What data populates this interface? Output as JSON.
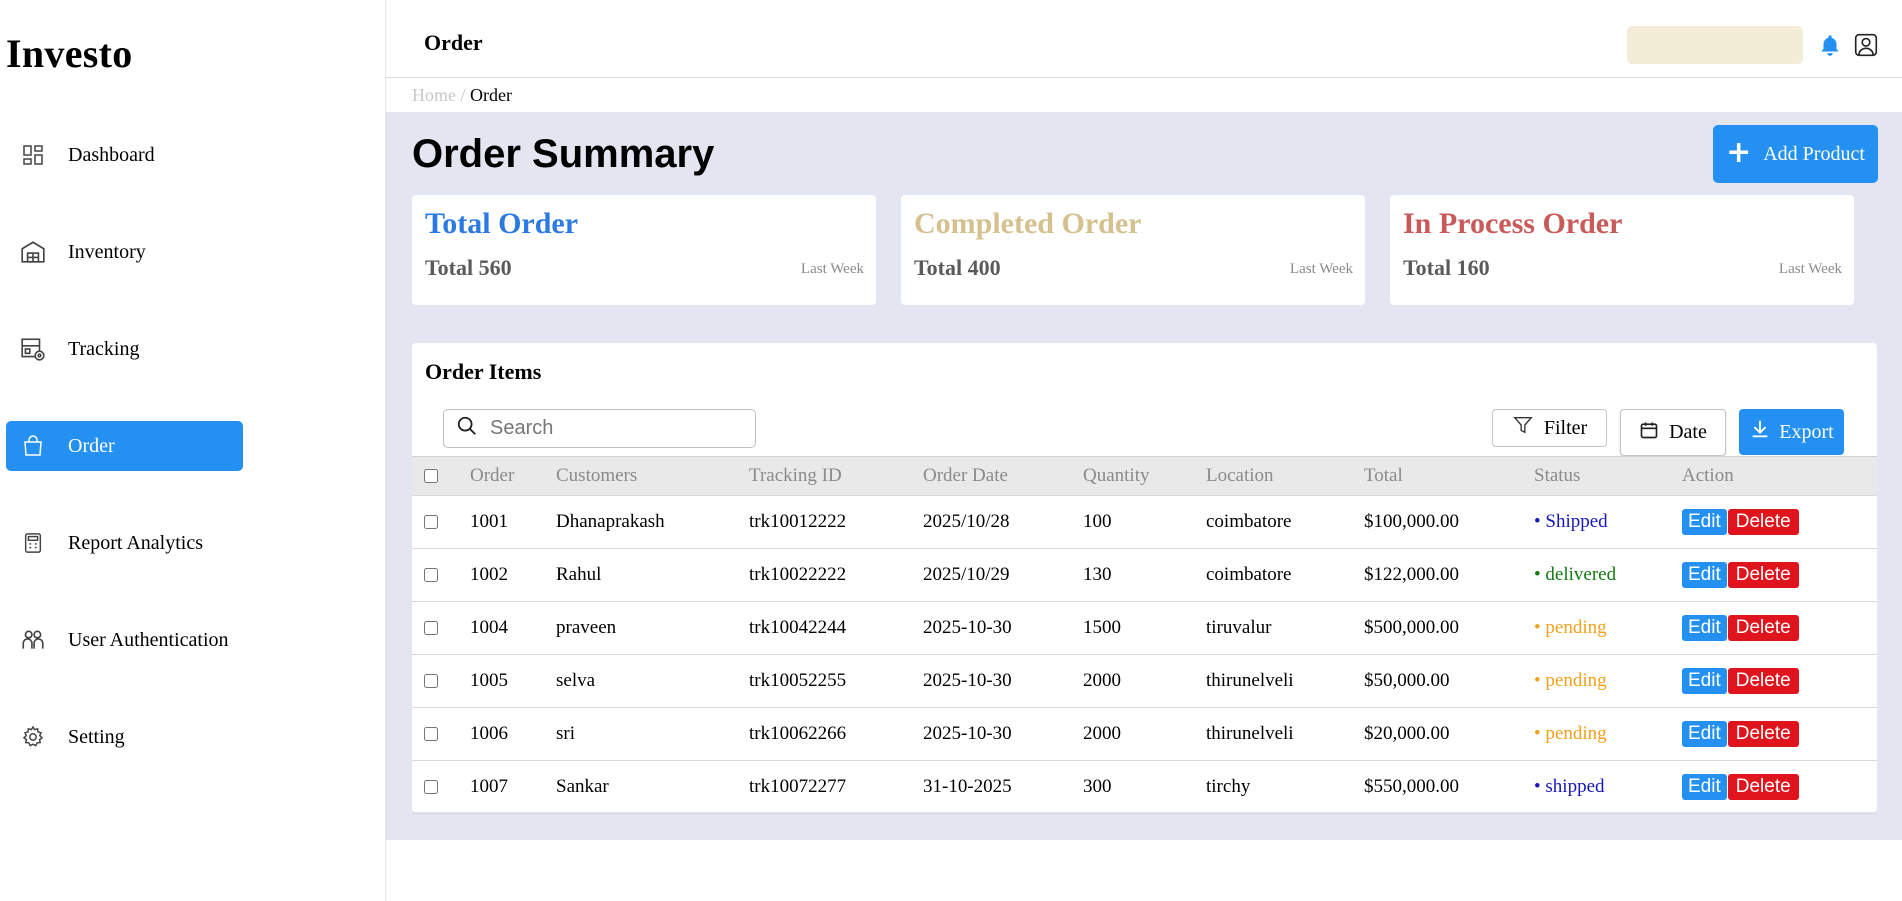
{
  "app": {
    "name": "Investo"
  },
  "sidebar": {
    "items": [
      {
        "label": "Dashboard",
        "icon": "dashboard-icon"
      },
      {
        "label": "Inventory",
        "icon": "warehouse-icon"
      },
      {
        "label": "Tracking",
        "icon": "tracking-box-icon"
      },
      {
        "label": "Order",
        "icon": "shopping-bag-icon",
        "active": true
      },
      {
        "label": "Report Analytics",
        "icon": "calculator-report-icon"
      },
      {
        "label": "User Authentication",
        "icon": "users-icon"
      },
      {
        "label": "Setting",
        "icon": "gear-icon"
      }
    ]
  },
  "header": {
    "title": "Order",
    "search_placeholder": ""
  },
  "breadcrumb": {
    "home": "Home",
    "separator": "/",
    "current": "Order"
  },
  "main": {
    "title": "Order Summary",
    "add_button": "Add Product",
    "cards": [
      {
        "title": "Total Order",
        "total": "Total 560",
        "period": "Last Week",
        "color": "#2a7ae2"
      },
      {
        "title": "Completed Order",
        "total": "Total 400",
        "period": "Last Week",
        "color": "#d6c08e"
      },
      {
        "title": "In Process Order",
        "total": "Total 160",
        "period": "Last Week",
        "color": "#c85a5a"
      }
    ]
  },
  "orders": {
    "title": "Order Items",
    "search_placeholder": "Search",
    "filter_label": "Filter",
    "date_label": "Date",
    "export_label": "Export",
    "columns": [
      "Order",
      "Customers",
      "Tracking ID",
      "Order Date",
      "Quantity",
      "Location",
      "Total",
      "Status",
      "Action"
    ],
    "rows": [
      {
        "order": "1001",
        "customer": "Dhanaprakash",
        "tracking": "trk10012222",
        "date": "2025/10/28",
        "qty": "100",
        "location": "coimbatore",
        "total": "$100,000.00",
        "status": "• Shipped",
        "status_color": "#1717b8"
      },
      {
        "order": "1002",
        "customer": "Rahul",
        "tracking": "trk10022222",
        "date": "2025/10/29",
        "qty": "130",
        "location": "coimbatore",
        "total": "$122,000.00",
        "status": "• delivered",
        "status_color": "#127a12"
      },
      {
        "order": "1004",
        "customer": "praveen",
        "tracking": "trk10042244",
        "date": "2025-10-30",
        "qty": "1500",
        "location": "tiruvalur",
        "total": "$500,000.00",
        "status": "• pending",
        "status_color": "#f0a21c"
      },
      {
        "order": "1005",
        "customer": "selva",
        "tracking": "trk10052255",
        "date": "2025-10-30",
        "qty": "2000",
        "location": "thirunelveli",
        "total": "$50,000.00",
        "status": "• pending",
        "status_color": "#f0a21c"
      },
      {
        "order": "1006",
        "customer": "sri",
        "tracking": "trk10062266",
        "date": "2025-10-30",
        "qty": "2000",
        "location": "thirunelveli",
        "total": "$20,000.00",
        "status": "• pending",
        "status_color": "#f0a21c"
      },
      {
        "order": "1007",
        "customer": "Sankar",
        "tracking": "trk10072277",
        "date": "31-10-2025",
        "qty": "300",
        "location": "tirchy",
        "total": "$550,000.00",
        "status": "• shipped",
        "status_color": "#1717b8"
      }
    ],
    "edit_label": "Edit",
    "delete_label": "Delete"
  },
  "colors": {
    "accent": "#2491f2",
    "main_bg": "#e3e6f1",
    "delete": "#e0141c",
    "header_search_bg": "#f3ecd7"
  }
}
